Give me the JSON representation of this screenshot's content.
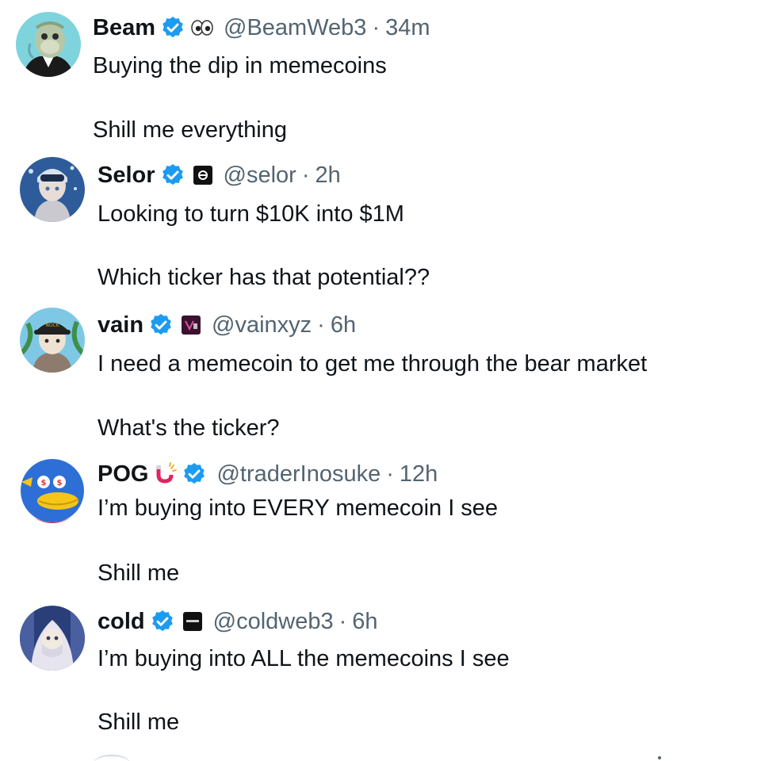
{
  "tweets": [
    {
      "name": "Beam",
      "handle": "@BeamWeb3",
      "separator": "·",
      "time": "34m",
      "lines": [
        "Buying the dip in memecoins",
        "Shill me everything"
      ]
    },
    {
      "name": "Selor",
      "handle": "@selor",
      "separator": "·",
      "time": "2h",
      "lines": [
        "Looking to turn $10K into $1M",
        "Which ticker has that potential??"
      ]
    },
    {
      "name": "vain",
      "handle": "@vainxyz",
      "separator": "·",
      "time": "6h",
      "lines": [
        "I need a memecoin to get me through the bear market",
        "What's the ticker?"
      ]
    },
    {
      "name": "POG",
      "handle": "@traderInosuke",
      "separator": "·",
      "time": "12h",
      "lines": [
        "I’m buying into EVERY memecoin I see",
        "Shill me"
      ]
    },
    {
      "name": "cold",
      "handle": "@coldweb3",
      "separator": "·",
      "time": "6h",
      "lines": [
        "I’m buying into ALL the memecoins I see",
        "Shill me"
      ]
    }
  ],
  "colors": {
    "verified": "#1d9bf0",
    "secondary_text": "#536471",
    "primary_text": "#0f1419"
  },
  "icons": {
    "verified": "verified-badge-icon",
    "beam_emoji": "eyes-emoji-icon",
    "pog_emoji": "magnet-emoji-icon",
    "affiliates": [
      "selor-affiliate-icon",
      "vain-affiliate-icon",
      "cold-affiliate-icon"
    ]
  }
}
